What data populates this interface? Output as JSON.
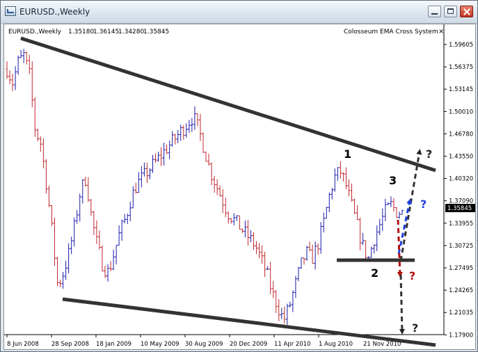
{
  "window": {
    "title": "EURUSD.,Weekly"
  },
  "chart_header": {
    "symbol_text": "EURUSD.,Weekly",
    "ohlc": [
      "1.35180",
      "1.36145",
      "1.34280",
      "1.35845"
    ],
    "indicator": "Colosseum EMA Cross System"
  },
  "price_axis": {
    "labels": [
      "1.59605",
      "1.56375",
      "1.53145",
      "1.50010",
      "1.46780",
      "1.43550",
      "1.40320",
      "1.37090",
      "1.33955",
      "1.30725",
      "1.27495",
      "1.24265",
      "1.21035",
      "1.17900"
    ],
    "current_price": "1.35845"
  },
  "time_axis": {
    "labels": [
      "8 Jun 2008",
      "28 Sep 2008",
      "18 Jan 2009",
      "10 May 2009",
      "30 Aug 2009",
      "20 Dec 2009",
      "11 Apr 2010",
      "1 Aug 2010",
      "21 Nov 2010"
    ]
  },
  "annotations": {
    "point1": "1",
    "point2": "2",
    "point3": "3",
    "q_top": "?",
    "q_blue": "?",
    "q_red": "?",
    "q_bottom": "?"
  },
  "colors": {
    "bull": "#1a1aa8",
    "bear": "#c0272d",
    "trendline": "#333333",
    "blue_arrow": "#1f3fe0",
    "red_arrow": "#b01010"
  },
  "chart_data": {
    "type": "candlestick",
    "symbol": "EURUSD.",
    "timeframe": "Weekly",
    "ylim": [
      1.179,
      1.615
    ],
    "x_tick_labels": [
      "8 Jun 2008",
      "28 Sep 2008",
      "18 Jan 2009",
      "10 May 2009",
      "30 Aug 2009",
      "20 Dec 2009",
      "11 Apr 2010",
      "1 Aug 2010",
      "21 Nov 2010"
    ],
    "close_path": [
      1.57,
      1.55,
      1.58,
      1.59,
      1.56,
      1.48,
      1.46,
      1.4,
      1.33,
      1.25,
      1.27,
      1.3,
      1.34,
      1.39,
      1.41,
      1.35,
      1.31,
      1.28,
      1.27,
      1.3,
      1.33,
      1.35,
      1.38,
      1.4,
      1.41,
      1.42,
      1.43,
      1.44,
      1.45,
      1.46,
      1.47,
      1.48,
      1.49,
      1.5,
      1.48,
      1.45,
      1.42,
      1.4,
      1.38,
      1.36,
      1.35,
      1.34,
      1.33,
      1.32,
      1.31,
      1.29,
      1.27,
      1.24,
      1.22,
      1.2,
      1.22,
      1.25,
      1.28,
      1.3,
      1.29,
      1.31,
      1.34,
      1.38,
      1.41,
      1.42,
      1.4,
      1.37,
      1.34,
      1.31,
      1.29,
      1.32,
      1.34,
      1.36,
      1.37,
      1.36,
      1.35845
    ],
    "trendlines": [
      {
        "name": "upper",
        "from": [
          "8 Jun 2008",
          1.602
        ],
        "to": [
          "end",
          1.418
        ]
      },
      {
        "name": "lower",
        "from": [
          "28 Sep 2008",
          1.229
        ],
        "to": [
          "end",
          1.169
        ]
      },
      {
        "name": "support",
        "from": [
          "1 Aug 2010",
          1.285
        ],
        "to": [
          "end",
          1.285
        ]
      }
    ]
  }
}
